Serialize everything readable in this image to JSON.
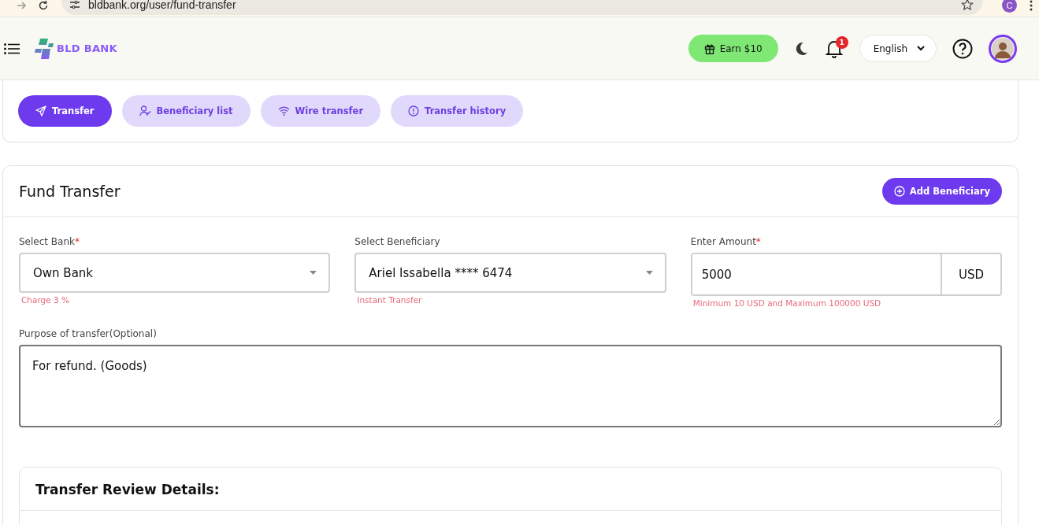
{
  "browser": {
    "url": "bldbank.org/user/fund-transfer",
    "profile_initial": "C"
  },
  "header": {
    "logo": "BLD BANK",
    "earn_button": "Earn $10",
    "notification_count": "1",
    "language": "English"
  },
  "tabs": [
    {
      "label": "Transfer",
      "selected": true
    },
    {
      "label": "Beneficiary list",
      "selected": false
    },
    {
      "label": "Wire transfer",
      "selected": false
    },
    {
      "label": "Transfer history",
      "selected": false
    }
  ],
  "form": {
    "title": "Fund Transfer",
    "add_button": "Add Beneficiary",
    "fields": [
      {
        "kind": "select",
        "label": "Select Bank",
        "required_mark": "*",
        "value": "Own Bank",
        "hint": "Charge 3 %"
      },
      {
        "kind": "select",
        "label": "Select Beneficiary",
        "value": "Ariel Issabella **** 6474",
        "hint": "Instant Transfer"
      },
      {
        "kind": "amount",
        "label": "Enter Amount",
        "required_mark": "*",
        "value": "5000",
        "unit": "USD",
        "hint": "Minimum 10 USD and Maximum 100000 USD"
      }
    ],
    "purpose": {
      "label": "Purpose of transfer(Optional)",
      "value": "For refund. (Goods)"
    }
  },
  "review": {
    "title": "Transfer Review Details:"
  }
}
